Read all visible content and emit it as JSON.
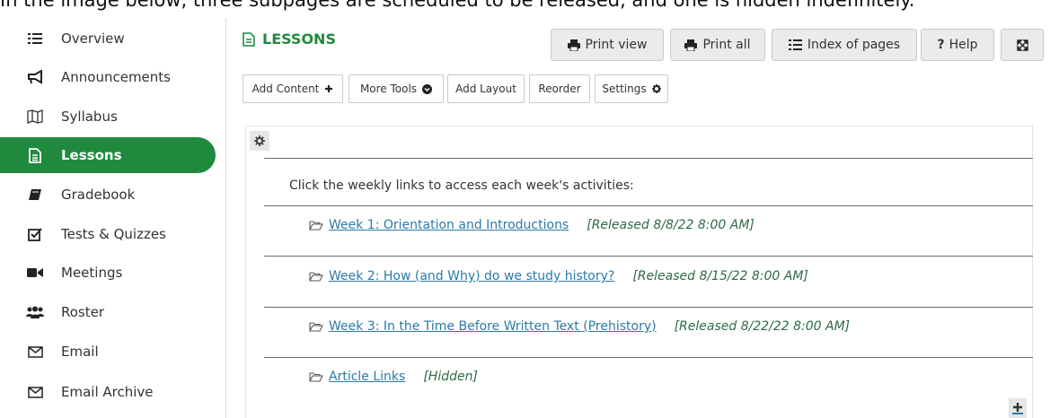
{
  "caption": "In the image below, three subpages are scheduled to be released, and one is hidden indefinitely.",
  "sidebar": {
    "items": [
      {
        "label": "Overview",
        "icon": "list-icon"
      },
      {
        "label": "Announcements",
        "icon": "megaphone-icon"
      },
      {
        "label": "Syllabus",
        "icon": "map-icon"
      },
      {
        "label": "Lessons",
        "icon": "document-icon",
        "active": true
      },
      {
        "label": "Gradebook",
        "icon": "book-icon"
      },
      {
        "label": "Tests & Quizzes",
        "icon": "checkbox-icon"
      },
      {
        "label": "Meetings",
        "icon": "video-camera-icon"
      },
      {
        "label": "Roster",
        "icon": "users-icon"
      },
      {
        "label": "Email",
        "icon": "envelope-icon"
      },
      {
        "label": "Email Archive",
        "icon": "envelope-icon"
      }
    ]
  },
  "header": {
    "title": "LESSONS",
    "print_view": "Print view",
    "print_all": "Print all",
    "index_of_pages": "Index of pages",
    "help": "Help"
  },
  "subtoolbar": {
    "add_content": "Add Content",
    "more_tools": "More Tools",
    "add_layout": "Add Layout",
    "reorder": "Reorder",
    "settings": "Settings"
  },
  "content": {
    "intro": "Click the weekly links to access each week's activities:",
    "subpages": [
      {
        "title": "Week 1: Orientation and Introductions",
        "status": "[Released 8/8/22 8:00 AM]"
      },
      {
        "title": "Week 2: How (and Why) do we study history?",
        "status": "[Released 8/15/22 8:00 AM]"
      },
      {
        "title": "Week 3: In the Time Before Written Text (Prehistory)",
        "status": "[Released 8/22/22 8:00 AM]"
      },
      {
        "title": "Article Links",
        "status": "[Hidden]"
      }
    ]
  },
  "colors": {
    "accent": "#1f8a3e",
    "link": "#2a7aa8",
    "release_text": "#2d6a46"
  }
}
